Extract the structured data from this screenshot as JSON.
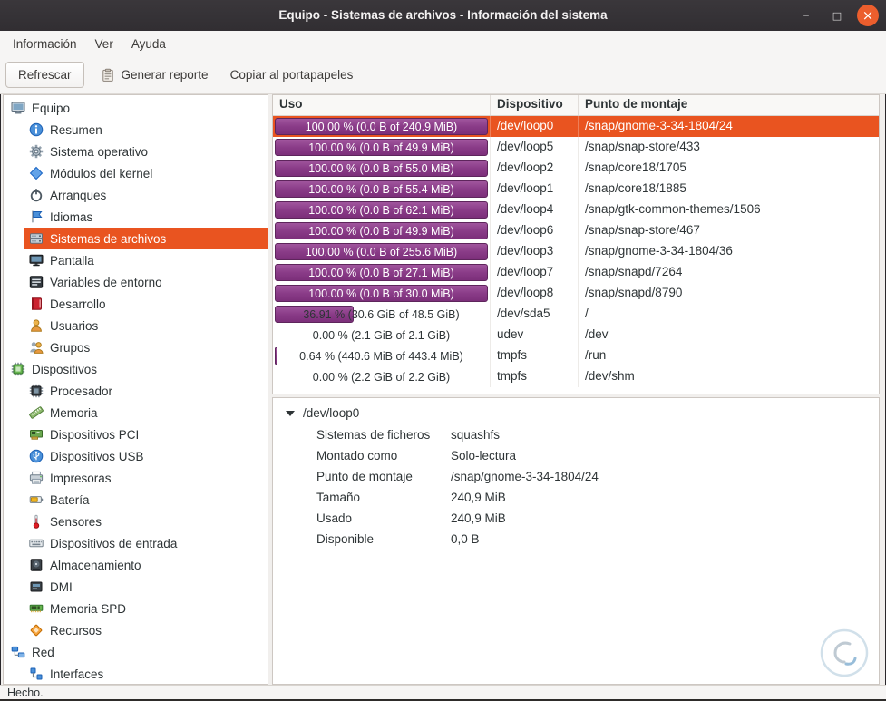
{
  "window": {
    "title": "Equipo - Sistemas de archivos - Información del sistema",
    "controls": {
      "minimize": "–",
      "maximize": "□",
      "close": "×"
    }
  },
  "menubar": {
    "items": [
      {
        "label": "Información",
        "name": "menu-information"
      },
      {
        "label": "Ver",
        "name": "menu-view"
      },
      {
        "label": "Ayuda",
        "name": "menu-help"
      }
    ]
  },
  "toolbar": {
    "buttons": [
      {
        "label": "Refrescar",
        "name": "refresh-button",
        "kind": "button"
      },
      {
        "label": "Generar reporte",
        "name": "generate-report-button",
        "kind": "flat",
        "icon": "clipboard-icon"
      },
      {
        "label": "Copiar al portapapeles",
        "name": "copy-to-clipboard-button",
        "kind": "flat"
      }
    ]
  },
  "sidebar": {
    "items": [
      {
        "label": "Equipo",
        "icon": "computer-icon",
        "level": 0
      },
      {
        "label": "Resumen",
        "icon": "info-icon",
        "level": 1
      },
      {
        "label": "Sistema operativo",
        "icon": "gear-icon",
        "level": 1
      },
      {
        "label": "Módulos del kernel",
        "icon": "diamond-icon",
        "level": 1
      },
      {
        "label": "Arranques",
        "icon": "power-icon",
        "level": 1
      },
      {
        "label": "Idiomas",
        "icon": "flag-icon",
        "level": 1
      },
      {
        "label": "Sistemas de archivos",
        "icon": "filesystem-icon",
        "level": 1,
        "selected": true
      },
      {
        "label": "Pantalla",
        "icon": "display-icon",
        "level": 1
      },
      {
        "label": "Variables de entorno",
        "icon": "terminal-icon",
        "level": 1
      },
      {
        "label": "Desarrollo",
        "icon": "book-icon",
        "level": 1
      },
      {
        "label": "Usuarios",
        "icon": "user-icon",
        "level": 1
      },
      {
        "label": "Grupos",
        "icon": "group-icon",
        "level": 1
      },
      {
        "label": "Dispositivos",
        "icon": "chip-green-icon",
        "level": 0
      },
      {
        "label": "Procesador",
        "icon": "chip-dark-icon",
        "level": 1
      },
      {
        "label": "Memoria",
        "icon": "ruler-icon",
        "level": 1
      },
      {
        "label": "Dispositivos PCI",
        "icon": "pci-icon",
        "level": 1
      },
      {
        "label": "Dispositivos USB",
        "icon": "usb-icon",
        "level": 1
      },
      {
        "label": "Impresoras",
        "icon": "printer-icon",
        "level": 1
      },
      {
        "label": "Batería",
        "icon": "battery-icon",
        "level": 1
      },
      {
        "label": "Sensores",
        "icon": "thermometer-icon",
        "level": 1
      },
      {
        "label": "Dispositivos de entrada",
        "icon": "keyboard-icon",
        "level": 1
      },
      {
        "label": "Almacenamiento",
        "icon": "storage-icon",
        "level": 1
      },
      {
        "label": "DMI",
        "icon": "dmi-icon",
        "level": 1
      },
      {
        "label": "Memoria SPD",
        "icon": "memory-stick-icon",
        "level": 1
      },
      {
        "label": "Recursos",
        "icon": "resources-icon",
        "level": 1
      },
      {
        "label": "Red",
        "icon": "network-icon",
        "level": 0
      },
      {
        "label": "Interfaces",
        "icon": "interface-icon",
        "level": 1
      }
    ]
  },
  "filesystem_table": {
    "columns": [
      "Uso",
      "Dispositivo",
      "Punto de montaje"
    ],
    "rows": [
      {
        "usage": "100.00 % (0.0 B of 240.9 MiB)",
        "percent": 100,
        "device": "/dev/loop0",
        "mount": "/snap/gnome-3-34-1804/24",
        "selected": true
      },
      {
        "usage": "100.00 % (0.0 B of 49.9 MiB)",
        "percent": 100,
        "device": "/dev/loop5",
        "mount": "/snap/snap-store/433"
      },
      {
        "usage": "100.00 % (0.0 B of 55.0 MiB)",
        "percent": 100,
        "device": "/dev/loop2",
        "mount": "/snap/core18/1705"
      },
      {
        "usage": "100.00 % (0.0 B of 55.4 MiB)",
        "percent": 100,
        "device": "/dev/loop1",
        "mount": "/snap/core18/1885"
      },
      {
        "usage": "100.00 % (0.0 B of 62.1 MiB)",
        "percent": 100,
        "device": "/dev/loop4",
        "mount": "/snap/gtk-common-themes/1506"
      },
      {
        "usage": "100.00 % (0.0 B of 49.9 MiB)",
        "percent": 100,
        "device": "/dev/loop6",
        "mount": "/snap/snap-store/467"
      },
      {
        "usage": "100.00 % (0.0 B of 255.6 MiB)",
        "percent": 100,
        "device": "/dev/loop3",
        "mount": "/snap/gnome-3-34-1804/36"
      },
      {
        "usage": "100.00 % (0.0 B of 27.1 MiB)",
        "percent": 100,
        "device": "/dev/loop7",
        "mount": "/snap/snapd/7264"
      },
      {
        "usage": "100.00 % (0.0 B of 30.0 MiB)",
        "percent": 100,
        "device": "/dev/loop8",
        "mount": "/snap/snapd/8790"
      },
      {
        "usage": "36.91 % (30.6 GiB of 48.5 GiB)",
        "percent": 36.91,
        "device": "/dev/sda5",
        "mount": "/"
      },
      {
        "usage": "0.00 % (2.1 GiB of 2.1 GiB)",
        "percent": 0,
        "device": "udev",
        "mount": "/dev"
      },
      {
        "usage": "0.64 % (440.6 MiB of 443.4 MiB)",
        "percent": 0.64,
        "device": "tmpfs",
        "mount": "/run"
      },
      {
        "usage": "0.00 % (2.2 GiB of 2.2 GiB)",
        "percent": 0,
        "device": "tmpfs",
        "mount": "/dev/shm"
      }
    ]
  },
  "details": {
    "expander": "/dev/loop0",
    "fields": [
      {
        "label": "Sistemas de ficheros",
        "value": "squashfs"
      },
      {
        "label": "Montado como",
        "value": "Solo-lectura"
      },
      {
        "label": "Punto de montaje",
        "value": "/snap/gnome-3-34-1804/24"
      },
      {
        "label": "Tamaño",
        "value": "240,9 MiB"
      },
      {
        "label": "Usado",
        "value": "240,9 MiB"
      },
      {
        "label": "Disponible",
        "value": "0,0 B"
      }
    ]
  },
  "statusbar": {
    "text": "Hecho."
  },
  "colors": {
    "accent": "#e95420",
    "bar_fill": "#8a3c88",
    "bar_border": "#5e255c",
    "titlebar": "#343036",
    "close_button": "#ec5e2d"
  }
}
